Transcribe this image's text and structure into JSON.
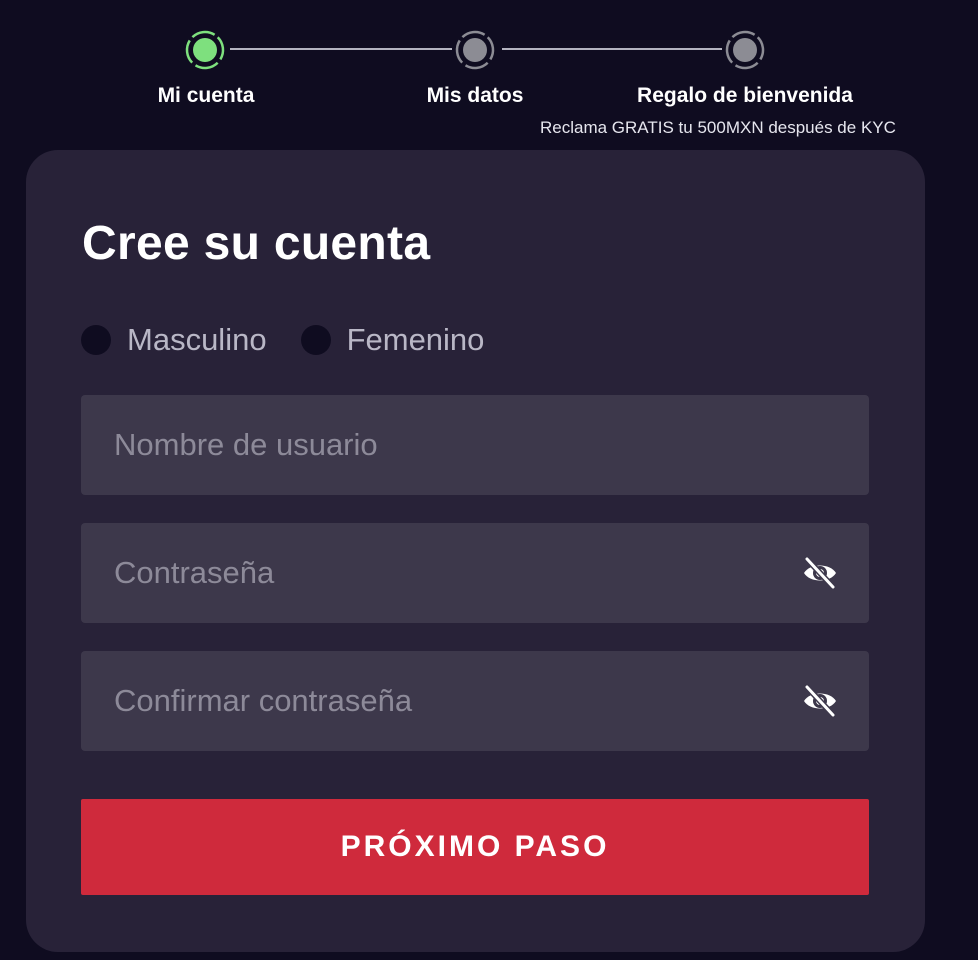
{
  "stepper": {
    "steps": [
      {
        "label": "Mi cuenta",
        "state": "active",
        "color": "#7ee07e"
      },
      {
        "label": "Mis datos",
        "state": "inactive",
        "color": "#8c8c94"
      },
      {
        "label": "Regalo de bienvenida",
        "state": "inactive",
        "color": "#8c8c94"
      }
    ],
    "subtitle": "Reclama GRATIS tu 500MXN después de KYC"
  },
  "form": {
    "title": "Cree su cuenta",
    "gender_options": [
      "Masculino",
      "Femenino"
    ],
    "username_placeholder": "Nombre de usuario",
    "password_placeholder": "Contraseña",
    "confirm_placeholder": "Confirmar contraseña",
    "password_toggle_icon": "eye-off-icon",
    "submit_label": "PRÓXIMO PASO"
  },
  "colors": {
    "background": "#0f0c20",
    "card": "#282238",
    "input": "#3d384b",
    "accent": "#cf2a3c",
    "active_step": "#7ee07e"
  }
}
